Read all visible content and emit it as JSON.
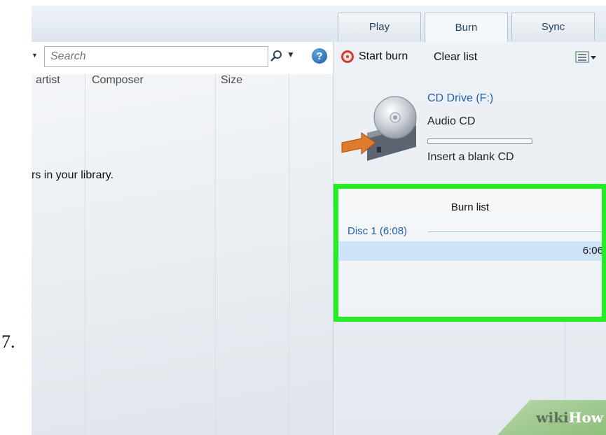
{
  "step_number": "7.",
  "tabs": [
    {
      "label": "Play",
      "active": false
    },
    {
      "label": "Burn",
      "active": true
    },
    {
      "label": "Sync",
      "active": false
    }
  ],
  "search": {
    "placeholder": "Search",
    "value": ""
  },
  "library": {
    "columns": [
      "artist",
      "Composer",
      "Size"
    ],
    "empty_message": "rs in your library."
  },
  "burn_toolbar": {
    "start_burn_label": "Start burn",
    "clear_list_label": "Clear list"
  },
  "drive": {
    "name": "CD Drive (F:)",
    "disc_type": "Audio CD",
    "status": "Insert a blank CD",
    "progress": 0
  },
  "burn_list": {
    "title": "Burn list",
    "disc_label": "Disc 1 (6:08)",
    "rows": [
      {
        "duration": "6:06",
        "selected": true
      }
    ]
  },
  "watermark": {
    "wiki": "wiki",
    "how": "How"
  },
  "colors": {
    "highlight": "#22ee22",
    "link_blue": "#1f5fae",
    "selection": "#cde3f7"
  }
}
